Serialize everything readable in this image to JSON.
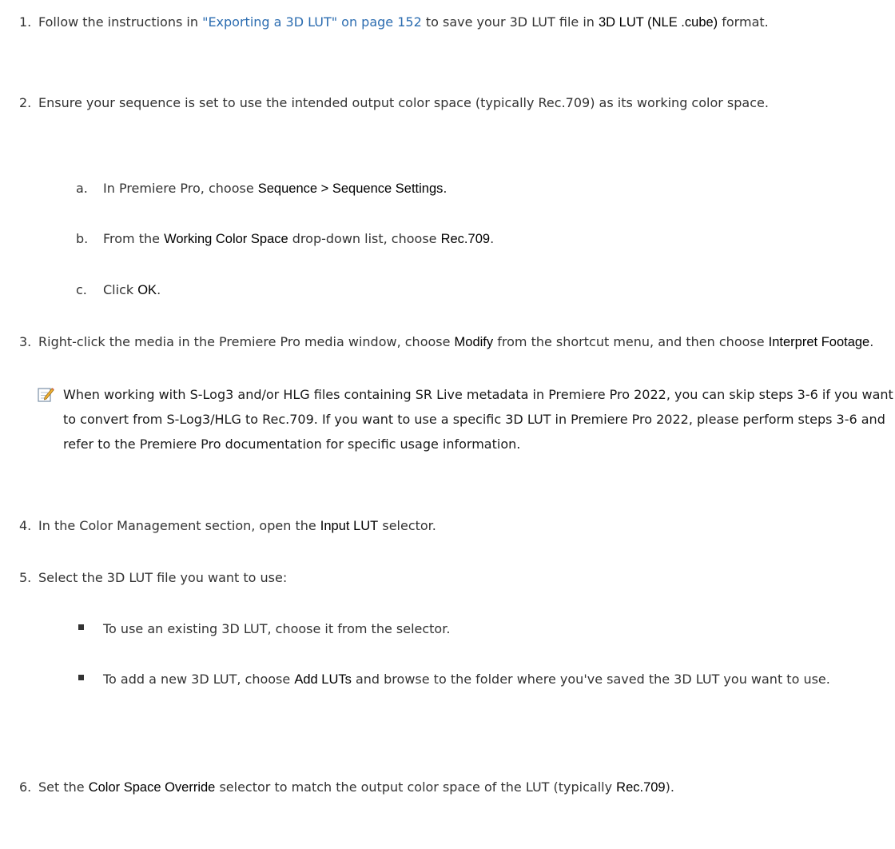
{
  "steps": [
    {
      "num": "1.",
      "a": "Follow the instructions in ",
      "link": "\"Exporting a 3D LUT\" on page 152",
      "b": " to save your 3D LUT file in ",
      "ui1": "3D LUT (NLE .cube)",
      "c": " format."
    },
    {
      "num": "2.",
      "a": "Ensure your sequence is set to use the intended output color space (typically Rec.709) as its working color space.",
      "subs": [
        {
          "letter": "a.",
          "a": "In Premiere Pro, choose ",
          "ui1": "Sequence > Sequence Settings",
          "b": "."
        },
        {
          "letter": "b.",
          "a": "From the ",
          "ui1": "Working Color Space",
          "b": " drop-down list, choose ",
          "ui2": "Rec.709",
          "c": "."
        },
        {
          "letter": "c.",
          "a": "Click ",
          "ui1": "OK",
          "b": "."
        }
      ]
    },
    {
      "num": "3.",
      "a": "Right-click the media in the Premiere Pro media window, choose ",
      "ui1": "Modify",
      "b": " from the shortcut menu, and then choose ",
      "ui2": "Interpret Footage",
      "c": "."
    },
    {
      "num": "4.",
      "a": "In the Color Management section, open the ",
      "ui1": "Input LUT",
      "b": " selector."
    },
    {
      "num": "5.",
      "a": "Select the 3D LUT file you want to use:",
      "bullets": [
        {
          "a": "To use an existing 3D LUT, choose it from the selector."
        },
        {
          "a": "To add a new 3D LUT, choose ",
          "ui1": "Add LUTs",
          "b": " and browse to the folder where you've saved the 3D LUT you want to use."
        }
      ]
    },
    {
      "num": "6.",
      "a": "Set the ",
      "ui1": "Color Space Override",
      "b": " selector to match the output color space of the LUT (typically ",
      "ui2": "Rec.709",
      "c": ")."
    }
  ],
  "note": {
    "icon": "note-icon",
    "text": "When working with S-Log3 and/or HLG files containing SR Live metadata in Premiere Pro 2022, you can skip steps 3-6 if you want to convert from S-Log3/HLG to Rec.709. If you want to use a specific 3D LUT in Premiere Pro 2022, please perform steps 3-6 and refer to the Premiere Pro documentation for specific usage information."
  }
}
